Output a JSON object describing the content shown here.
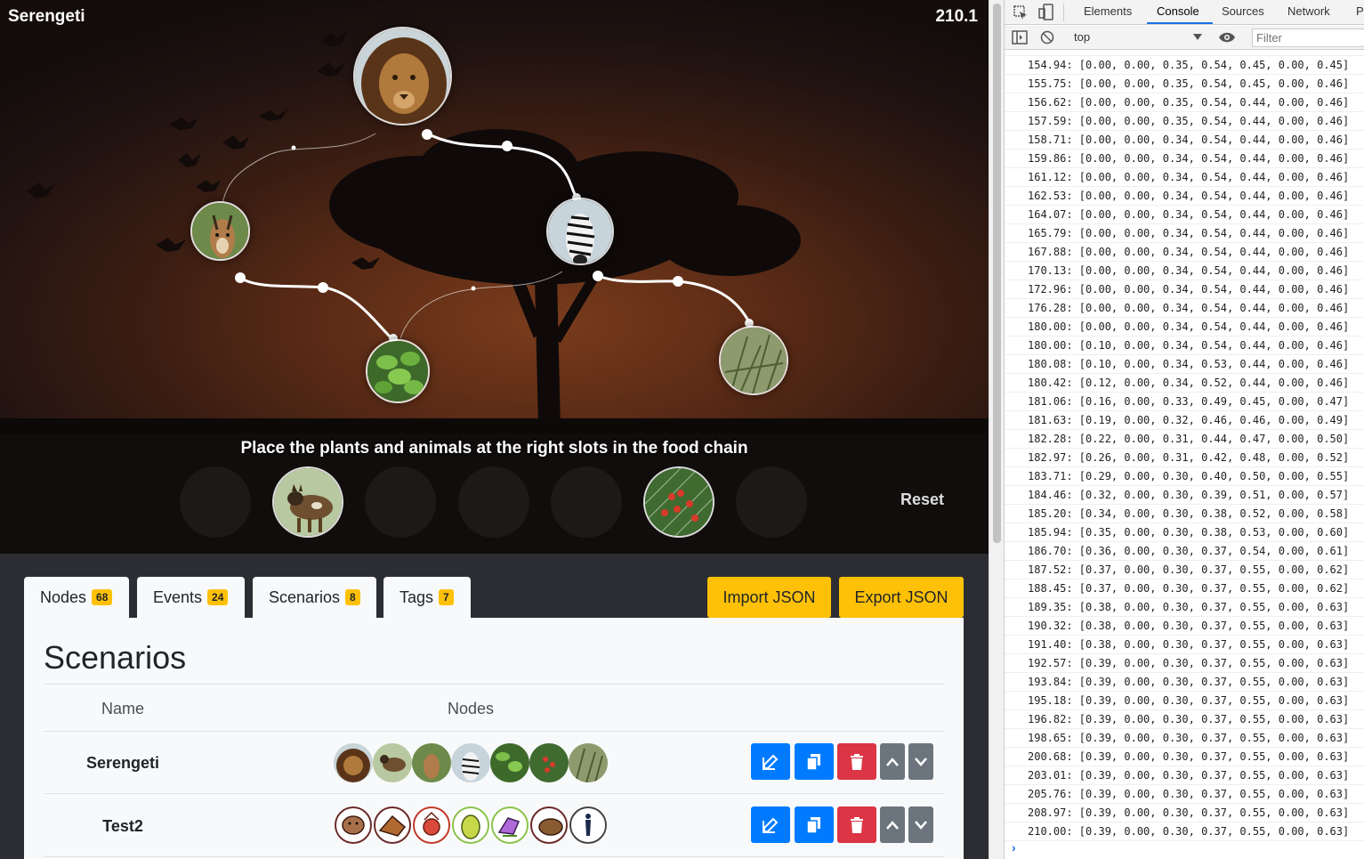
{
  "game": {
    "title": "Serengeti",
    "score": "210.1",
    "instruction": "Place the plants and animals at the right slots in the food chain",
    "reset_label": "Reset"
  },
  "panel": {
    "tabs": [
      {
        "label": "Nodes",
        "count": "68"
      },
      {
        "label": "Events",
        "count": "24"
      },
      {
        "label": "Scenarios",
        "count": "8"
      },
      {
        "label": "Tags",
        "count": "7"
      }
    ],
    "import_label": "Import JSON",
    "export_label": "Export JSON",
    "title": "Scenarios",
    "columns": {
      "name": "Name",
      "nodes": "Nodes"
    },
    "rows": [
      {
        "name": "Serengeti"
      },
      {
        "name": "Test2"
      }
    ]
  },
  "devtools": {
    "tabs": [
      "Elements",
      "Console",
      "Sources",
      "Network",
      "Pe"
    ],
    "active_tab": "Console",
    "context": "top",
    "filter_placeholder": "Filter",
    "logs": [
      "154.94: [0.00, 0.00, 0.35, 0.54, 0.45, 0.00, 0.45]",
      "155.75: [0.00, 0.00, 0.35, 0.54, 0.45, 0.00, 0.46]",
      "156.62: [0.00, 0.00, 0.35, 0.54, 0.44, 0.00, 0.46]",
      "157.59: [0.00, 0.00, 0.35, 0.54, 0.44, 0.00, 0.46]",
      "158.71: [0.00, 0.00, 0.34, 0.54, 0.44, 0.00, 0.46]",
      "159.86: [0.00, 0.00, 0.34, 0.54, 0.44, 0.00, 0.46]",
      "161.12: [0.00, 0.00, 0.34, 0.54, 0.44, 0.00, 0.46]",
      "162.53: [0.00, 0.00, 0.34, 0.54, 0.44, 0.00, 0.46]",
      "164.07: [0.00, 0.00, 0.34, 0.54, 0.44, 0.00, 0.46]",
      "165.79: [0.00, 0.00, 0.34, 0.54, 0.44, 0.00, 0.46]",
      "167.88: [0.00, 0.00, 0.34, 0.54, 0.44, 0.00, 0.46]",
      "170.13: [0.00, 0.00, 0.34, 0.54, 0.44, 0.00, 0.46]",
      "172.96: [0.00, 0.00, 0.34, 0.54, 0.44, 0.00, 0.46]",
      "176.28: [0.00, 0.00, 0.34, 0.54, 0.44, 0.00, 0.46]",
      "180.00: [0.00, 0.00, 0.34, 0.54, 0.44, 0.00, 0.46]",
      "180.00: [0.10, 0.00, 0.34, 0.54, 0.44, 0.00, 0.46]",
      "180.08: [0.10, 0.00, 0.34, 0.53, 0.44, 0.00, 0.46]",
      "180.42: [0.12, 0.00, 0.34, 0.52, 0.44, 0.00, 0.46]",
      "181.06: [0.16, 0.00, 0.33, 0.49, 0.45, 0.00, 0.47]",
      "181.63: [0.19, 0.00, 0.32, 0.46, 0.46, 0.00, 0.49]",
      "182.28: [0.22, 0.00, 0.31, 0.44, 0.47, 0.00, 0.50]",
      "182.97: [0.26, 0.00, 0.31, 0.42, 0.48, 0.00, 0.52]",
      "183.71: [0.29, 0.00, 0.30, 0.40, 0.50, 0.00, 0.55]",
      "184.46: [0.32, 0.00, 0.30, 0.39, 0.51, 0.00, 0.57]",
      "185.20: [0.34, 0.00, 0.30, 0.38, 0.52, 0.00, 0.58]",
      "185.94: [0.35, 0.00, 0.30, 0.38, 0.53, 0.00, 0.60]",
      "186.70: [0.36, 0.00, 0.30, 0.37, 0.54, 0.00, 0.61]",
      "187.52: [0.37, 0.00, 0.30, 0.37, 0.55, 0.00, 0.62]",
      "188.45: [0.37, 0.00, 0.30, 0.37, 0.55, 0.00, 0.62]",
      "189.35: [0.38, 0.00, 0.30, 0.37, 0.55, 0.00, 0.63]",
      "190.32: [0.38, 0.00, 0.30, 0.37, 0.55, 0.00, 0.63]",
      "191.40: [0.38, 0.00, 0.30, 0.37, 0.55, 0.00, 0.63]",
      "192.57: [0.39, 0.00, 0.30, 0.37, 0.55, 0.00, 0.63]",
      "193.84: [0.39, 0.00, 0.30, 0.37, 0.55, 0.00, 0.63]",
      "195.18: [0.39, 0.00, 0.30, 0.37, 0.55, 0.00, 0.63]",
      "196.82: [0.39, 0.00, 0.30, 0.37, 0.55, 0.00, 0.63]",
      "198.65: [0.39, 0.00, 0.30, 0.37, 0.55, 0.00, 0.63]",
      "200.68: [0.39, 0.00, 0.30, 0.37, 0.55, 0.00, 0.63]",
      "203.01: [0.39, 0.00, 0.30, 0.37, 0.55, 0.00, 0.63]",
      "205.76: [0.39, 0.00, 0.30, 0.37, 0.55, 0.00, 0.63]",
      "208.97: [0.39, 0.00, 0.30, 0.37, 0.55, 0.00, 0.63]",
      "210.00: [0.39, 0.00, 0.30, 0.37, 0.55, 0.00, 0.63]"
    ]
  },
  "colors": {
    "accent_yellow": "#ffc107",
    "button_blue": "#007bff",
    "button_red": "#dc3545",
    "devtools_blue": "#1a73e8"
  },
  "icons": {
    "edit": "edit-icon",
    "copy": "copy-icon",
    "delete": "trash-icon",
    "up": "chevron-up-icon",
    "down": "chevron-down-icon"
  }
}
